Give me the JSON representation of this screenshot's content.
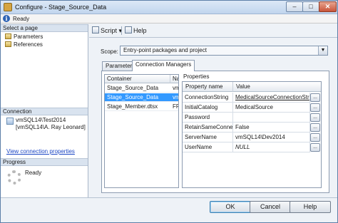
{
  "window": {
    "title": "Configure - Stage_Source_Data",
    "minimize": "–",
    "maximize": "□",
    "close": "✕"
  },
  "status": {
    "text": "Ready",
    "icon": "info-icon"
  },
  "left_pane": {
    "select_page_header": "Select a page",
    "pages": [
      {
        "label": "Parameters",
        "icon": "page-icon"
      },
      {
        "label": "References",
        "icon": "page-icon"
      }
    ],
    "connection_header": "Connection",
    "connection_lines": [
      "vmSQL14\\Test2014",
      "[vmSQL14\\A. Ray Leonard]"
    ],
    "view_connection_link": "View connection properties",
    "progress_header": "Progress",
    "progress_text": "Ready"
  },
  "toolbar": {
    "script_label": "Script",
    "script_arrow": "▾",
    "help_label": "Help"
  },
  "scope": {
    "label": "Scope:",
    "value": "Entry-point packages and project",
    "arrow": "▼"
  },
  "tabs": [
    {
      "label": "Parameters",
      "active": false
    },
    {
      "label": "Connection Managers",
      "active": true
    }
  ],
  "containers_grid": {
    "columns": [
      "Container",
      "Name"
    ],
    "rows": [
      {
        "container": "Stage_Source_Data",
        "name": "vm",
        "selected": false
      },
      {
        "container": "Stage_Source_Data",
        "name": "vm",
        "selected": true
      },
      {
        "container": "Stage_Member.dtsx",
        "name": "FF",
        "selected": false
      }
    ]
  },
  "properties": {
    "label": "Properties",
    "columns": [
      "Property name",
      "Value"
    ],
    "rows": [
      {
        "name": "ConnectionString",
        "value": "MedicalSourceConnectionString",
        "style": "underline"
      },
      {
        "name": "InitialCatalog",
        "value": "MedicalSource",
        "style": ""
      },
      {
        "name": "Password",
        "value": "",
        "style": ""
      },
      {
        "name": "RetainSameConnec...",
        "value": "False",
        "style": ""
      },
      {
        "name": "ServerName",
        "value": "vmSQL14\\Dev2014",
        "style": ""
      },
      {
        "name": "UserName",
        "value": "NULL",
        "style": "italic"
      }
    ],
    "ellipsis_label": "..."
  },
  "buttons": {
    "ok": "OK",
    "cancel": "Cancel",
    "help": "Help"
  }
}
